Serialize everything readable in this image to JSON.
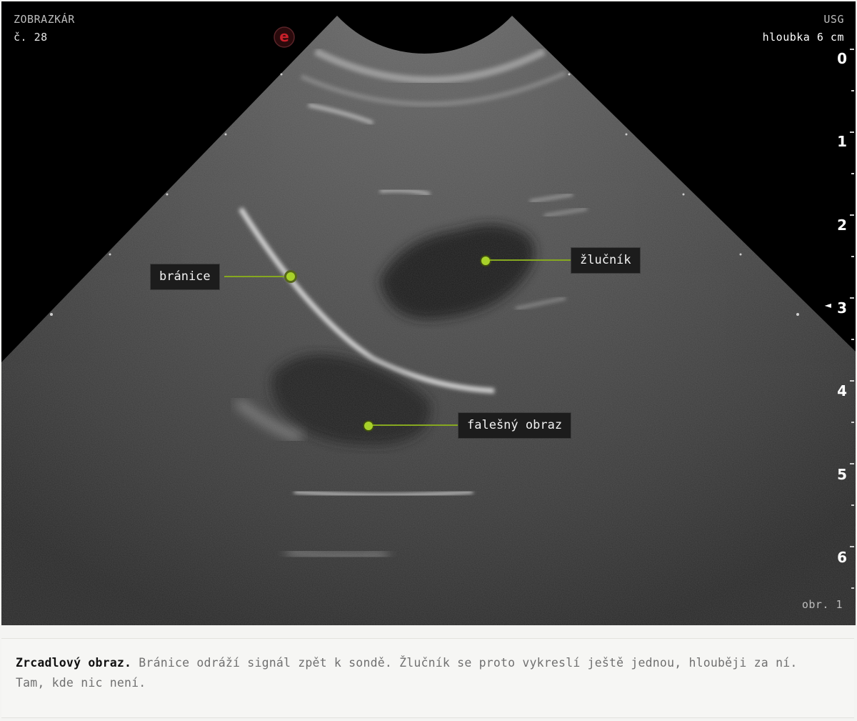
{
  "header": {
    "app_name": "ZOBRAZKÁR",
    "item_number": "č. 28",
    "modality": "USG",
    "depth": "hloubka 6 cm"
  },
  "depth_scale": [
    "0",
    "1",
    "2",
    "3",
    "4",
    "5",
    "6"
  ],
  "focus_marker": "◄",
  "figure_label": "obr. 1",
  "labels": {
    "diaphragm": "bránice",
    "gallbladder": "žlučník",
    "mirror": "falešný obraz"
  },
  "caption": {
    "title": "Zrcadlový obraz.",
    "text": "Bránice odráží signál zpět k sondě. Žlučník se proto vykreslí ještě jednou, hlouběji za ní. Tam, kde nic není."
  },
  "colors": {
    "accent": "#a8d22a",
    "background": "#000000",
    "caption_bg": "#f6f6f4"
  },
  "logo": {
    "glyph": "e",
    "color": "#c8202a"
  }
}
